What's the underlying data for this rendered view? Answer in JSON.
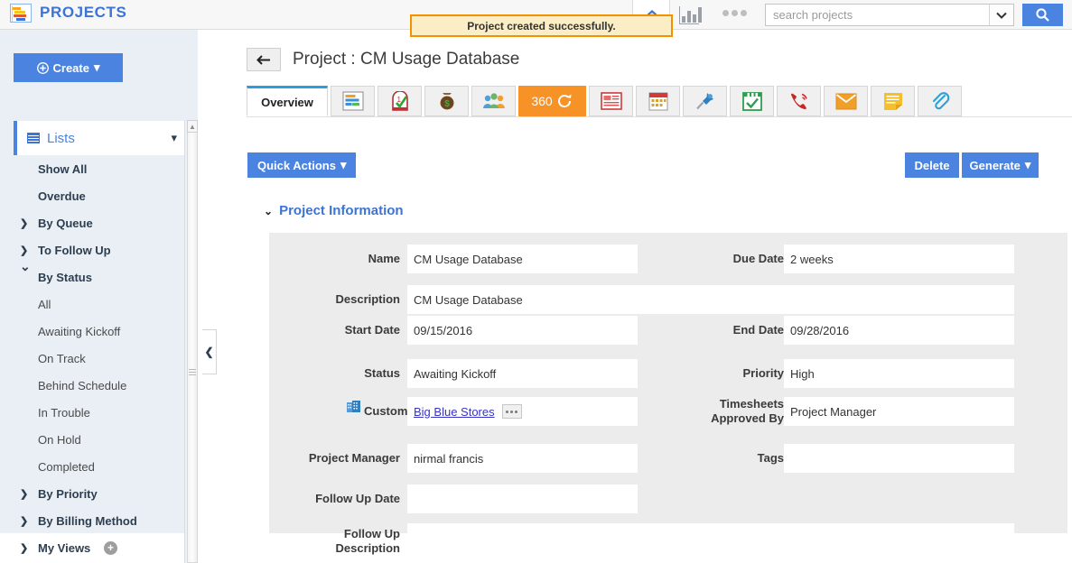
{
  "header": {
    "app_title": "PROJECTS",
    "logo_icon": "projects-gantt-icon",
    "home_icon": "home-icon",
    "reports_icon": "bar-chart-icon",
    "more_icon": "more-horizontal-icon",
    "search_placeholder": "search projects",
    "search_value": "",
    "search_icon": "magnifier-icon",
    "dropdown_icon": "chevron-down-icon"
  },
  "notification": {
    "message": "Project created successfully.",
    "border_color": "#f39200",
    "background_color": "#fbeec4"
  },
  "sidebar": {
    "create_label": "Create",
    "create_icon": "plus-circle-icon",
    "create_caret": "▾",
    "lists_label": "Lists",
    "lists_icon": "grid-icon",
    "lists_caret": "chevron-down-icon",
    "collapse_icon": "chevron-left-icon",
    "scroll_up_icon": "triangle-up-icon",
    "items": [
      {
        "label": "Show All",
        "level": "plain",
        "arrow": ""
      },
      {
        "label": "Overdue",
        "level": "plain",
        "arrow": ""
      },
      {
        "label": "By Queue",
        "level": "l1",
        "arrow": "›"
      },
      {
        "label": "To Follow Up",
        "level": "l1",
        "arrow": "›"
      },
      {
        "label": "By Status",
        "level": "l1",
        "arrow": "⌄"
      },
      {
        "label": "All",
        "level": "l2",
        "arrow": ""
      },
      {
        "label": "Awaiting Kickoff",
        "level": "l2",
        "arrow": ""
      },
      {
        "label": "On Track",
        "level": "l2",
        "arrow": ""
      },
      {
        "label": "Behind Schedule",
        "level": "l2",
        "arrow": ""
      },
      {
        "label": "In Trouble",
        "level": "l2",
        "arrow": ""
      },
      {
        "label": "On Hold",
        "level": "l2",
        "arrow": ""
      },
      {
        "label": "Completed",
        "level": "l2",
        "arrow": ""
      },
      {
        "label": "By Priority",
        "level": "l1",
        "arrow": "›"
      },
      {
        "label": "By Billing Method",
        "level": "l1",
        "arrow": "›"
      },
      {
        "label": "My Views",
        "level": "l1",
        "arrow": "›",
        "add_button": "+"
      }
    ]
  },
  "main": {
    "back_icon": "arrow-left-icon",
    "page_title": "Project : CM Usage Database",
    "tabs": [
      {
        "label": "Overview",
        "type": "text",
        "name": "tab-overview",
        "active": true
      },
      {
        "label": "",
        "type": "icon",
        "name": "tab-tasks",
        "icon": "gantt-chart-icon"
      },
      {
        "label": "",
        "type": "icon",
        "name": "tab-milestones",
        "icon": "checklist-icon"
      },
      {
        "label": "",
        "type": "icon",
        "name": "tab-expenses",
        "icon": "money-bag-icon"
      },
      {
        "label": "",
        "type": "icon",
        "name": "tab-team",
        "icon": "people-group-icon"
      },
      {
        "label": "360",
        "type": "t360",
        "name": "tab-360",
        "icon": "refresh-circle-icon"
      },
      {
        "label": "",
        "type": "icon",
        "name": "tab-news",
        "icon": "news-document-icon"
      },
      {
        "label": "",
        "type": "icon",
        "name": "tab-calendar",
        "icon": "calendar-icon"
      },
      {
        "label": "",
        "type": "icon",
        "name": "tab-pinned",
        "icon": "pushpin-icon"
      },
      {
        "label": "",
        "type": "icon",
        "name": "tab-saved",
        "icon": "floppy-disk-icon"
      },
      {
        "label": "",
        "type": "icon",
        "name": "tab-calls",
        "icon": "phone-icon"
      },
      {
        "label": "",
        "type": "icon",
        "name": "tab-email",
        "icon": "envelope-icon"
      },
      {
        "label": "",
        "type": "icon",
        "name": "tab-notes",
        "icon": "note-icon"
      },
      {
        "label": "",
        "type": "icon",
        "name": "tab-attachments",
        "icon": "paperclip-icon"
      }
    ],
    "quick_actions_label": "Quick Actions",
    "quick_actions_caret": "▾",
    "delete_label": "Delete",
    "generate_label": "Generate",
    "generate_caret": "▾",
    "section_title": "Project Information",
    "section_caret": "⌄",
    "fields": {
      "name_label": "Name",
      "name_value": "CM Usage Database",
      "due_date_label": "Due Date",
      "due_date_value": "2 weeks",
      "description_label": "Description",
      "description_value": "CM Usage Database",
      "start_date_label": "Start Date",
      "start_date_value": "09/15/2016",
      "end_date_label": "End Date",
      "end_date_value": "09/28/2016",
      "status_label": "Status",
      "status_value": "Awaiting Kickoff",
      "priority_label": "Priority",
      "priority_value": "High",
      "customer_label": "Customer",
      "customer_value": "Big Blue Stores",
      "customer_icon": "building-icon",
      "customer_more_icon": "ellipsis-icon",
      "timesheets_label": "Timesheets\nApproved By",
      "timesheets_label_line1": "Timesheets",
      "timesheets_label_line2": "Approved By",
      "timesheets_value": "Project Manager",
      "project_manager_label": "Project Manager",
      "project_manager_value": "nirmal francis",
      "tags_label": "Tags",
      "tags_value": "",
      "follow_up_date_label": "Follow Up Date",
      "follow_up_date_value": "",
      "follow_up_desc_label_line1": "Follow Up",
      "follow_up_desc_label_line2": "Description",
      "follow_up_desc_value": ""
    }
  },
  "colors": {
    "brand_blue": "#4a83e0",
    "accent_orange": "#f79226",
    "link_blue": "#3933c6",
    "panel_grey": "#ececec",
    "sidebar_bg": "#eaeff5"
  }
}
